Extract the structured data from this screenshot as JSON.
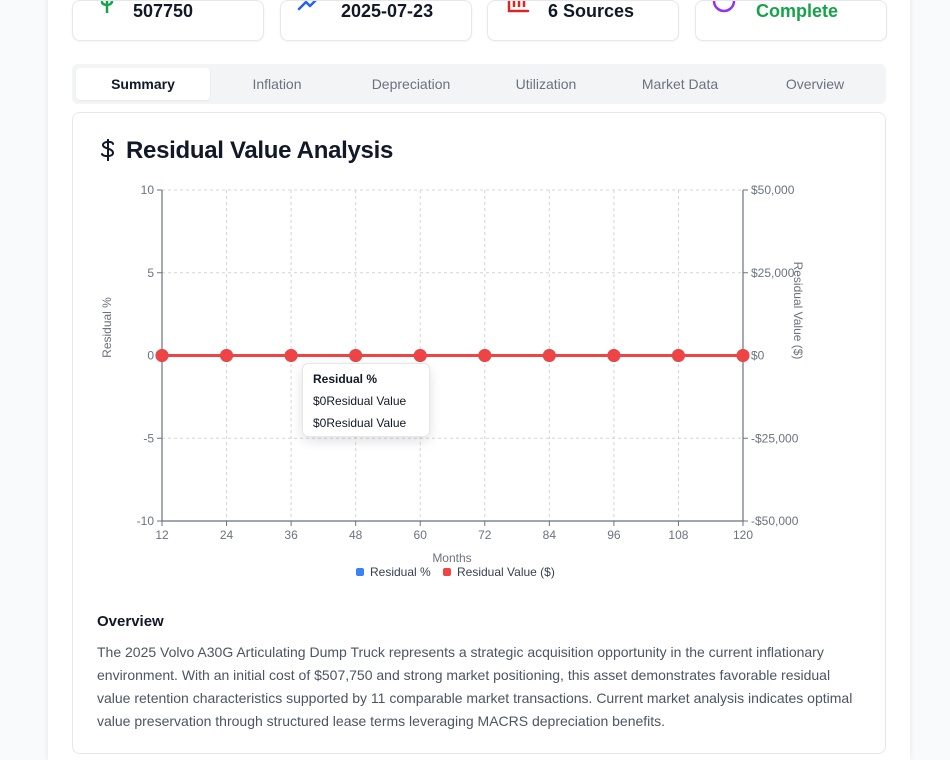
{
  "stats": [
    {
      "icon": "dollar-icon",
      "value": "507750"
    },
    {
      "icon": "trending-up-icon",
      "value": "2025-07-23"
    },
    {
      "icon": "bar-chart-icon",
      "value": "6 Sources"
    },
    {
      "icon": "loader-icon",
      "value": "Complete"
    }
  ],
  "tabs": [
    "Summary",
    "Inflation",
    "Depreciation",
    "Utilization",
    "Market Data",
    "Overview"
  ],
  "active_tab": "Summary",
  "panel": {
    "title": "Residual Value Analysis"
  },
  "tooltip": {
    "title": "Residual %",
    "line1": "$0Residual Value",
    "line2": "$0Residual Value"
  },
  "overview": {
    "heading": "Overview",
    "text": "The 2025 Volvo A30G Articulating Dump Truck represents a strategic acquisition opportunity in the current inflationary environment. With an initial cost of $507,750 and strong market positioning, this asset demonstrates favorable residual value retention characteristics supported by 11 comparable market transactions. Current market analysis indicates optimal value preservation through structured lease terms leveraging MACRS depreciation benefits."
  },
  "colors": {
    "blue": "#3b82f6",
    "red": "#ef4444",
    "green": "#16a34a",
    "purple": "#9333ea"
  },
  "chart_data": {
    "type": "line",
    "xlabel": "Months",
    "ylabel": "Residual %",
    "y2label": "Residual Value ($)",
    "x": [
      12,
      24,
      36,
      48,
      60,
      72,
      84,
      96,
      108,
      120
    ],
    "ylim": [
      -10,
      10
    ],
    "y2lim": [
      -50000,
      50000
    ],
    "yticks": [
      "10",
      "5",
      "0",
      "-5",
      "-10"
    ],
    "y2ticks": [
      "$50,000",
      "$25,000",
      "$0",
      "-$25,000",
      "-$50,000"
    ],
    "grid": true,
    "legend": "bottom",
    "series": [
      {
        "name": "Residual %",
        "color": "#3b82f6",
        "axis": "left",
        "values": [
          0,
          0,
          0,
          0,
          0,
          0,
          0,
          0,
          0,
          0
        ]
      },
      {
        "name": "Residual Value ($)",
        "color": "#ef4444",
        "axis": "right",
        "values": [
          0,
          0,
          0,
          0,
          0,
          0,
          0,
          0,
          0,
          0
        ]
      }
    ]
  }
}
